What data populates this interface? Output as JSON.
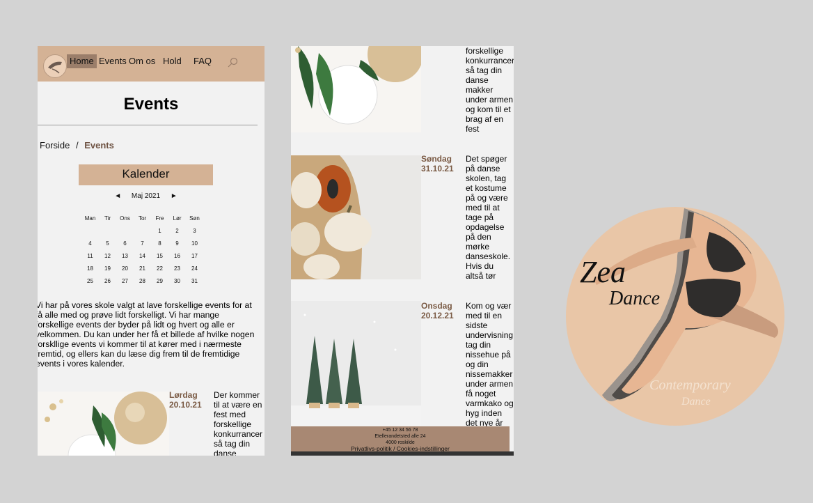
{
  "nav": {
    "items": [
      {
        "label": "Home",
        "active": true
      },
      {
        "label": "Events",
        "active": false
      },
      {
        "label": "Om os",
        "active": false
      },
      {
        "label": "Hold",
        "active": false
      },
      {
        "label": "FAQ",
        "active": false
      }
    ],
    "search_icon": "search-icon"
  },
  "page": {
    "title": "Events"
  },
  "breadcrumb": {
    "home": "Forside",
    "separator": "/",
    "current": "Events"
  },
  "calendar": {
    "title": "Kalender",
    "prev": "◄",
    "month": "Maj 2021",
    "next": "►",
    "weekdays": [
      "Man",
      "Tir",
      "Ons",
      "Tor",
      "Fre",
      "Lør",
      "Søn"
    ],
    "weeks": [
      [
        "",
        "",
        "",
        "",
        "1",
        "2",
        "3"
      ],
      [
        "4",
        "5",
        "6",
        "7",
        "8",
        "9",
        "10"
      ],
      [
        "11",
        "12",
        "13",
        "14",
        "15",
        "16",
        "17"
      ],
      [
        "18",
        "19",
        "20",
        "21",
        "22",
        "23",
        "24"
      ],
      [
        "25",
        "26",
        "27",
        "28",
        "29",
        "30",
        "31"
      ]
    ]
  },
  "intro": {
    "lines": [
      "Vi har på vores skole valgt at lave forskellige events for at",
      "få alle med og prøve lidt forskelligt. Vi har mange",
      "forskellige events der byder på lidt og hvert og alle er",
      "velkommen. Du kan under her få et billede af hvilke nogen",
      "forskllige events vi kommer til at kører med i nærmeste",
      "fremtid, og ellers kan du læse dig frem til de fremtidige",
      "events i vores kalender."
    ]
  },
  "events": {
    "saturday": {
      "day": "Lørdag",
      "date": "20.10.21",
      "lines_left": [
        "Der kommer",
        "til at være en",
        "fest med",
        "forskellige",
        "konkurrancer",
        "så tag din",
        "danse"
      ],
      "lines_mid": [
        "forskellige",
        "konkurrancer",
        "så tag din",
        "danse",
        "makker",
        "under armen",
        "og kom til et",
        "brag af en",
        "fest"
      ]
    },
    "sunday": {
      "day": "Søndag",
      "date": "31.10.21",
      "lines": [
        "Det spøger",
        "på danse",
        "skolen, tag",
        "et kostume",
        "på og være",
        "med til at",
        "tage på",
        "opdagelse",
        "på den",
        "mørke",
        "danseskole.",
        "Hvis du",
        "altså tør"
      ]
    },
    "wednesday": {
      "day": "Onsdag",
      "date": "20.12.21",
      "lines": [
        "Kom og vær",
        "med til en",
        "sidste",
        "undervisning",
        "tag din",
        "nissehue på",
        "og din",
        "nissemakker",
        "under armen",
        "få noget",
        "varmkako og",
        "hyg inden",
        "det nye år"
      ]
    }
  },
  "footer": {
    "phone": "+45 12 34 56 78",
    "address": "Etellerandetsted alle 24",
    "city": "4000 roskilde",
    "links": "Privatlivs-politik / Cookies-indstillinger"
  },
  "logo": {
    "word1": "Zea",
    "word2": "Dance",
    "sub1": "Contemporary",
    "sub2": "Dance"
  },
  "colors": {
    "nav_bg": "#d4b295",
    "active_nav": "#9b7e6a",
    "date_brown": "#7a5a44",
    "footer_bg": "#a88873",
    "logo_circle": "#e9c6a7"
  }
}
